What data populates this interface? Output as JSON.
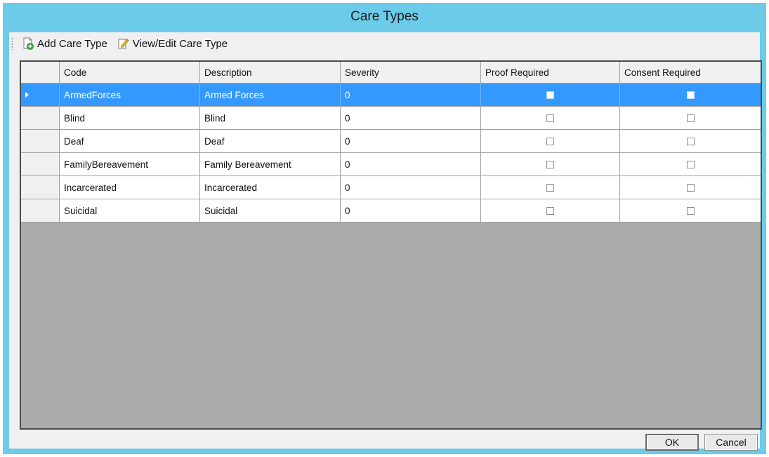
{
  "window": {
    "title": "Care Types"
  },
  "toolbar": {
    "add_label": "Add Care Type",
    "edit_label": "View/Edit Care Type"
  },
  "grid": {
    "columns": [
      "Code",
      "Description",
      "Severity",
      "Proof Required",
      "Consent Required"
    ],
    "rows": [
      {
        "code": "ArmedForces",
        "description": "Armed Forces",
        "severity": "0",
        "proof_required": false,
        "consent_required": false,
        "selected": true
      },
      {
        "code": "Blind",
        "description": "Blind",
        "severity": "0",
        "proof_required": false,
        "consent_required": false
      },
      {
        "code": "Deaf",
        "description": "Deaf",
        "severity": "0",
        "proof_required": false,
        "consent_required": false
      },
      {
        "code": "FamilyBereavement",
        "description": "Family Bereavement",
        "severity": "0",
        "proof_required": false,
        "consent_required": false
      },
      {
        "code": "Incarcerated",
        "description": "Incarcerated",
        "severity": "0",
        "proof_required": false,
        "consent_required": false
      },
      {
        "code": "Suicidal",
        "description": "Suicidal",
        "severity": "0",
        "proof_required": false,
        "consent_required": false
      }
    ]
  },
  "buttons": {
    "ok_label": "OK",
    "cancel_label": "Cancel"
  },
  "colors": {
    "titlebar": "#6ccbe9",
    "selection": "#3399ff",
    "grid_empty": "#ababab"
  }
}
